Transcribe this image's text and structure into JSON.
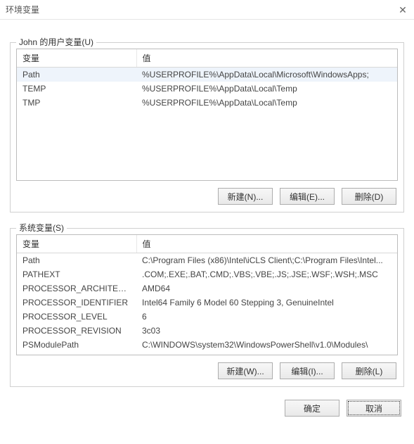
{
  "window": {
    "title": "环境变量",
    "close_glyph": "✕"
  },
  "user_section": {
    "label": "John 的用户变量(U)",
    "headers": {
      "name": "变量",
      "value": "值"
    },
    "rows": [
      {
        "name": "Path",
        "value": "%USERPROFILE%\\AppData\\Local\\Microsoft\\WindowsApps;",
        "selected": true
      },
      {
        "name": "TEMP",
        "value": "%USERPROFILE%\\AppData\\Local\\Temp",
        "selected": false
      },
      {
        "name": "TMP",
        "value": "%USERPROFILE%\\AppData\\Local\\Temp",
        "selected": false
      }
    ],
    "buttons": {
      "new": "新建(N)...",
      "edit": "编辑(E)...",
      "delete": "删除(D)"
    }
  },
  "system_section": {
    "label": "系统变量(S)",
    "headers": {
      "name": "变量",
      "value": "值"
    },
    "rows": [
      {
        "name": "Path",
        "value": "C:\\Program Files (x86)\\Intel\\iCLS Client\\;C:\\Program Files\\Intel..."
      },
      {
        "name": "PATHEXT",
        "value": ".COM;.EXE;.BAT;.CMD;.VBS;.VBE;.JS;.JSE;.WSF;.WSH;.MSC"
      },
      {
        "name": "PROCESSOR_ARCHITECT...",
        "value": "AMD64"
      },
      {
        "name": "PROCESSOR_IDENTIFIER",
        "value": "Intel64 Family 6 Model 60 Stepping 3, GenuineIntel"
      },
      {
        "name": "PROCESSOR_LEVEL",
        "value": "6"
      },
      {
        "name": "PROCESSOR_REVISION",
        "value": "3c03"
      },
      {
        "name": "PSModulePath",
        "value": "C:\\WINDOWS\\system32\\WindowsPowerShell\\v1.0\\Modules\\"
      }
    ],
    "buttons": {
      "new": "新建(W)...",
      "edit": "编辑(I)...",
      "delete": "删除(L)"
    }
  },
  "dialog_buttons": {
    "ok": "确定",
    "cancel": "取消"
  }
}
